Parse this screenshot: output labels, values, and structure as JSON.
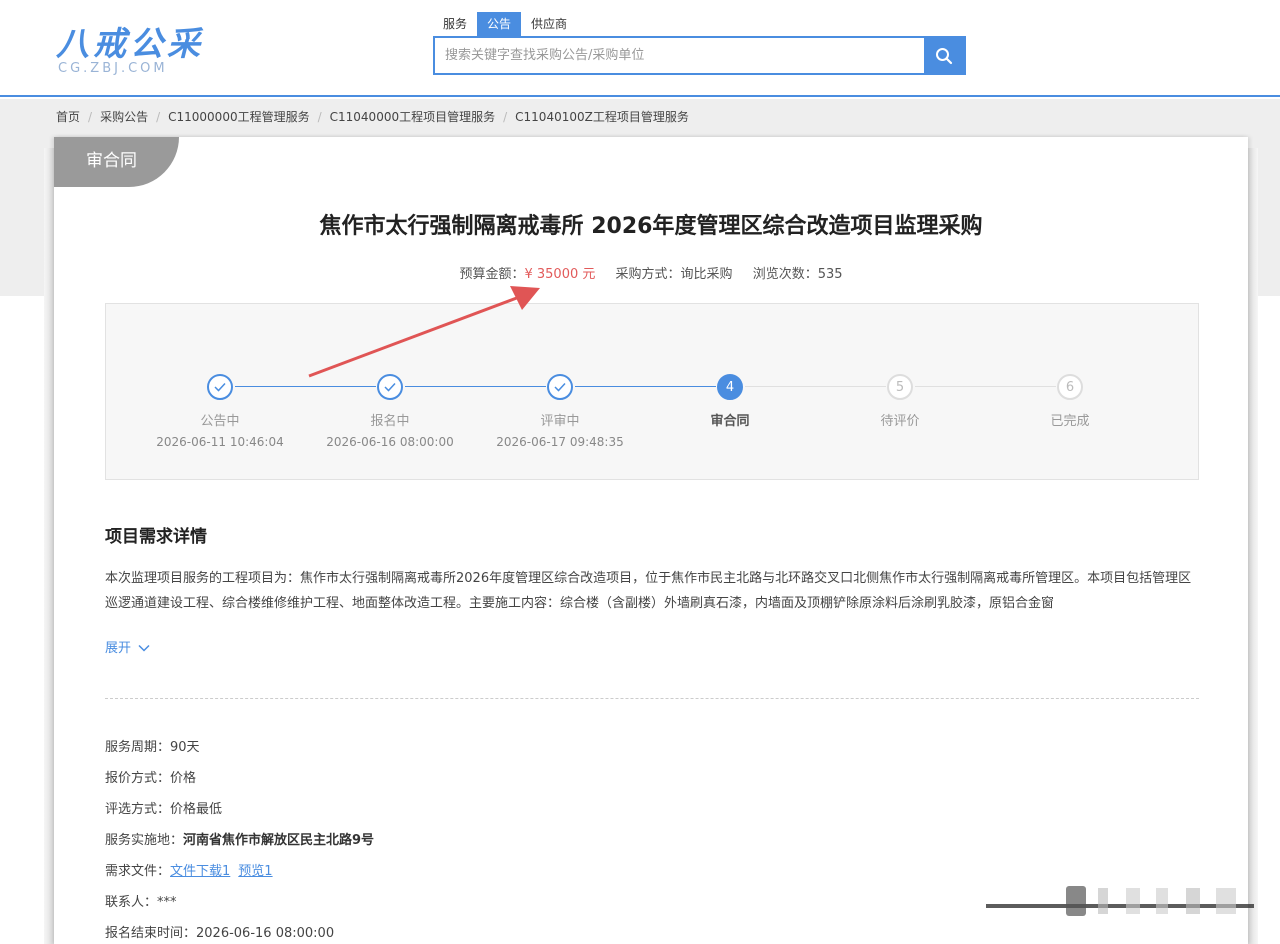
{
  "logo": {
    "cn": "八戒公采",
    "en": "CG.ZBJ.COM"
  },
  "search": {
    "tabs": [
      "服务",
      "公告",
      "供应商"
    ],
    "active_tab": "公告",
    "placeholder": "搜索关键字查找采购公告/采购单位",
    "icon": "search-icon"
  },
  "breadcrumb": [
    "首页",
    "采购公告",
    "C11000000工程管理服务",
    "C11040000工程项目管理服务",
    "C11040100Z工程项目管理服务"
  ],
  "status_tag": "审合同",
  "title": "焦作市太行强制隔离戒毒所 2026年度管理区综合改造项目监理采购",
  "meta": {
    "budget_label": "预算金额：",
    "budget_value": "¥ 35000 元",
    "method": "采购方式：询比采购",
    "views": "浏览次数：535"
  },
  "steps": [
    {
      "num": "1",
      "label": "公告中",
      "time": "2026-06-11 10:46:04",
      "state": "done"
    },
    {
      "num": "2",
      "label": "报名中",
      "time": "2026-06-16 08:00:00",
      "state": "done"
    },
    {
      "num": "3",
      "label": "评审中",
      "time": "2026-06-17 09:48:35",
      "state": "done"
    },
    {
      "num": "4",
      "label": "审合同",
      "time": "",
      "state": "current"
    },
    {
      "num": "5",
      "label": "待评价",
      "time": "",
      "state": "todo"
    },
    {
      "num": "6",
      "label": "已完成",
      "time": "",
      "state": "todo"
    }
  ],
  "details": {
    "section_title": "项目需求详情",
    "description": "本次监理项目服务的工程项目为：焦作市太行强制隔离戒毒所2026年度管理区综合改造项目，位于焦作市民主北路与北环路交叉口北侧焦作市太行强制隔离戒毒所管理区。本项目包括管理区巡逻通道建设工程、综合楼维修维护工程、地面整体改造工程。主要施工内容：综合楼（含副楼）外墙刷真石漆，内墙面及顶棚铲除原涂料后涂刷乳胶漆，原铝合金窗",
    "expand": "展开"
  },
  "info": {
    "service_period_label": "服务周期：",
    "service_period": "90天",
    "quote_label": "报价方式：",
    "quote": "价格",
    "selection_label": "评选方式：",
    "selection": "价格最低",
    "location_label": "服务实施地：",
    "location": "河南省焦作市解放区民主北路9号",
    "files_label": "需求文件：",
    "file_download": "文件下载1",
    "file_preview": "预览1",
    "contact_label": "联系人：",
    "contact": "***",
    "deadline_label": "报名结束时间：",
    "deadline": "2026-06-16 08:00:00"
  },
  "colors": {
    "accent": "#4a8de0",
    "price": "#e25a5a",
    "tag": "#9a9a9a",
    "arrow": "#e05555"
  }
}
